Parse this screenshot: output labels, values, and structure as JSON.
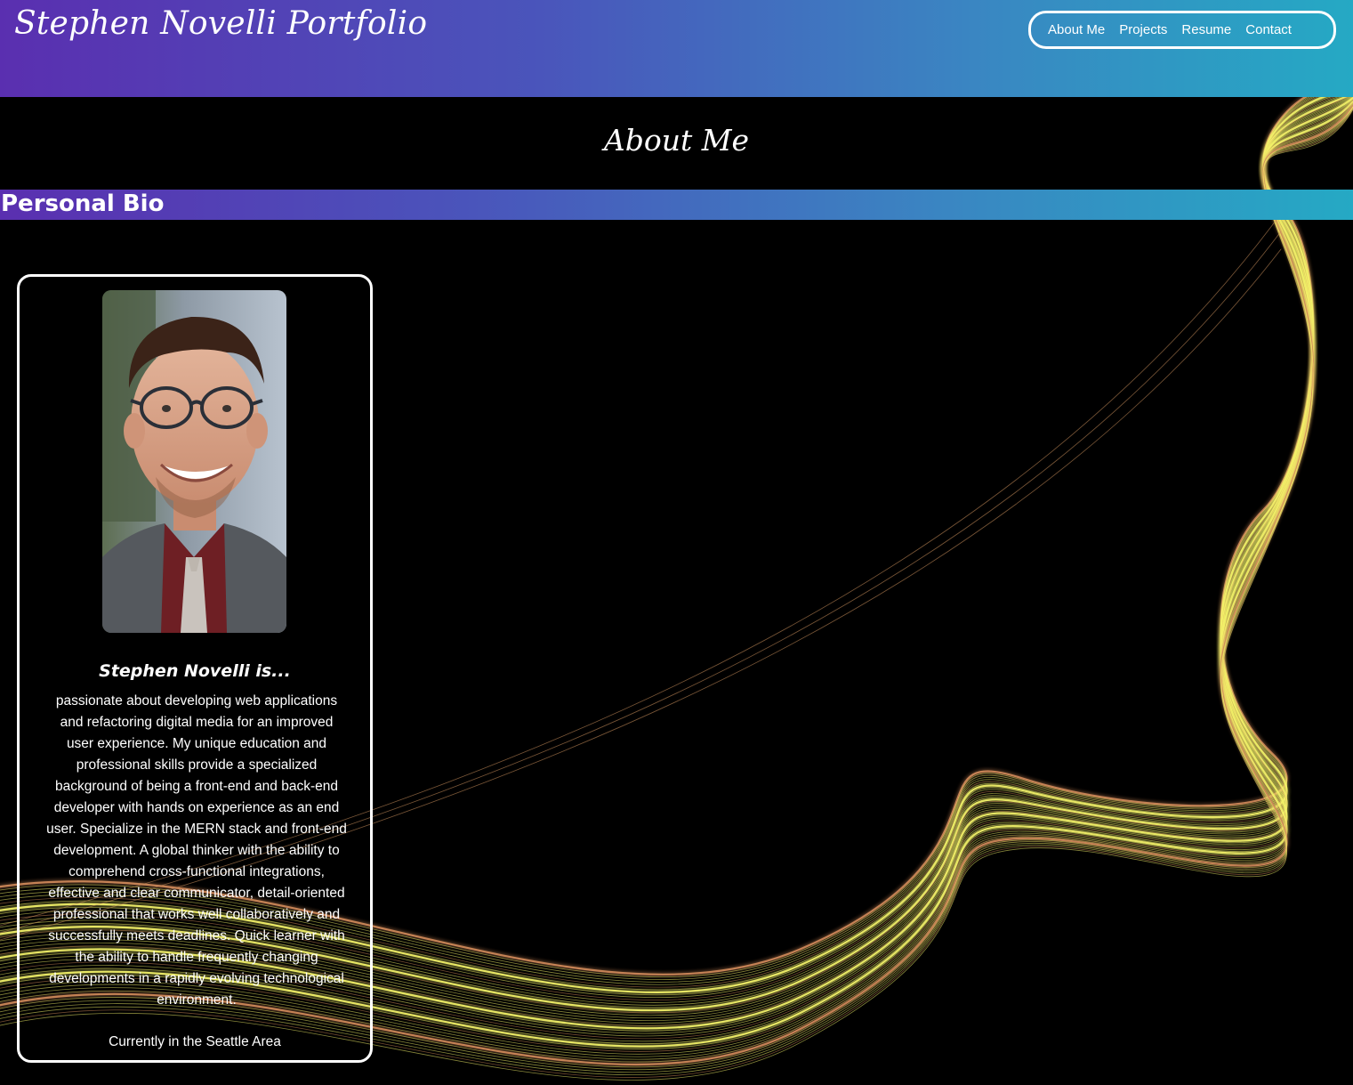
{
  "header": {
    "site_title": "Stephen Novelli Portfolio",
    "nav": [
      {
        "label": "About Me"
      },
      {
        "label": "Projects"
      },
      {
        "label": "Resume"
      },
      {
        "label": "Contact"
      }
    ]
  },
  "main": {
    "section_title": "About Me",
    "bio_section": {
      "title": "Personal Bio",
      "card": {
        "name_heading": "Stephen Novelli is...",
        "bio_text": "passionate about developing web applications and refactoring digital media for an improved user experience. My unique education and professional skills provide a specialized background of being a front-end and back-end developer with hands on experience as an end user. Specialize in the MERN stack and front-end development. A global thinker with the ability to comprehend cross-functional integrations, effective and clear communicator, detail-oriented professional that works well collaboratively and successfully meets deadlines. Quick learner with the ability to handle frequently changing developments in a rapidly evolving technological environment.",
        "location": "Currently in the Seattle Area"
      }
    }
  },
  "colors": {
    "gradient_start": "#5a2fb0",
    "gradient_end": "#25a9c4",
    "background": "#000000",
    "light_streaks": "#f4f36a"
  }
}
